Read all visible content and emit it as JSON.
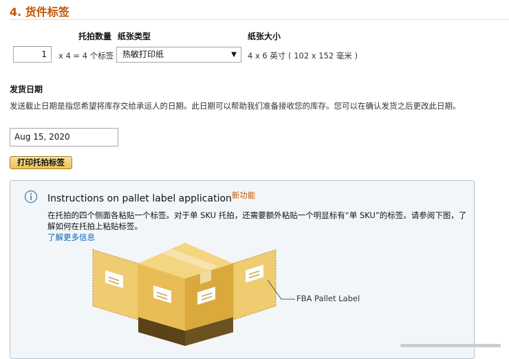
{
  "section": {
    "title": "4. 货件标签"
  },
  "table": {
    "headers": {
      "qty": "托拍数量",
      "paper_type": "纸张类型",
      "paper_size": "纸张大小"
    },
    "qty_value": "1",
    "multiplier_text": "x 4 = 4 个标签",
    "paper_type_selected": "热敏打印纸",
    "paper_size_value": "4 x 6 英寸 ( 102 x 152 毫米 )"
  },
  "ship_date": {
    "heading": "发货日期",
    "description": "发送截止日期是指您希望将库存交给承运人的日期。此日期可以帮助我们准备接收您的库存。您可以在确认发货之后更改此日期。",
    "value": "Aug 15, 2020"
  },
  "print_button": {
    "label": "打印托拍标签"
  },
  "info": {
    "title": "Instructions on pallet label application",
    "new_badge": "新功能",
    "body": "在托拍的四个侧面各粘贴一个标签。对于单 SKU 托拍，还需要额外粘贴一个明显标有“单 SKU”的标签。请参阅下图，了解如何在托拍上粘贴标签。",
    "learn_more": "了解更多信息",
    "diagram_label": "FBA Pallet Label"
  },
  "colors": {
    "title": "#c45500",
    "link": "#0066c0",
    "button": "#f0c14b",
    "box_light": "#f3d27a",
    "box_mid": "#e8bd55",
    "box_dark": "#d9a93c",
    "pallet": "#5a4318"
  }
}
